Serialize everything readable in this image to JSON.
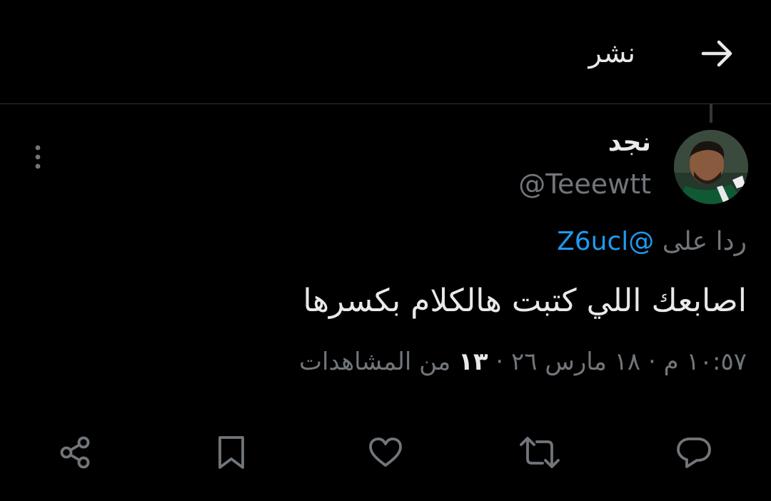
{
  "header": {
    "title": "نشر",
    "back_icon": "arrow-right-icon"
  },
  "post": {
    "author": {
      "name": "نجد",
      "handle": "@Teeewtt"
    },
    "reply_prefix": "ردا على",
    "reply_to": "@Z6ucl",
    "text": "اصابعك اللي كتبت هالكلام بكسرها",
    "time": "١٠:٥٧ م",
    "date": "١٨ مارس ٢٦",
    "views_count": "١٣",
    "views_label": "من المشاهدات",
    "separator": "·"
  },
  "actions": [
    {
      "name": "reply",
      "icon": "comment-icon"
    },
    {
      "name": "repost",
      "icon": "repost-icon"
    },
    {
      "name": "like",
      "icon": "heart-icon"
    },
    {
      "name": "bookmark",
      "icon": "bookmark-icon"
    },
    {
      "name": "share",
      "icon": "share-icon"
    }
  ],
  "colors": {
    "background": "#000000",
    "text_primary": "#e7e9ea",
    "text_secondary": "#71767b",
    "accent": "#1d9bf0",
    "divider": "#2f3336"
  }
}
